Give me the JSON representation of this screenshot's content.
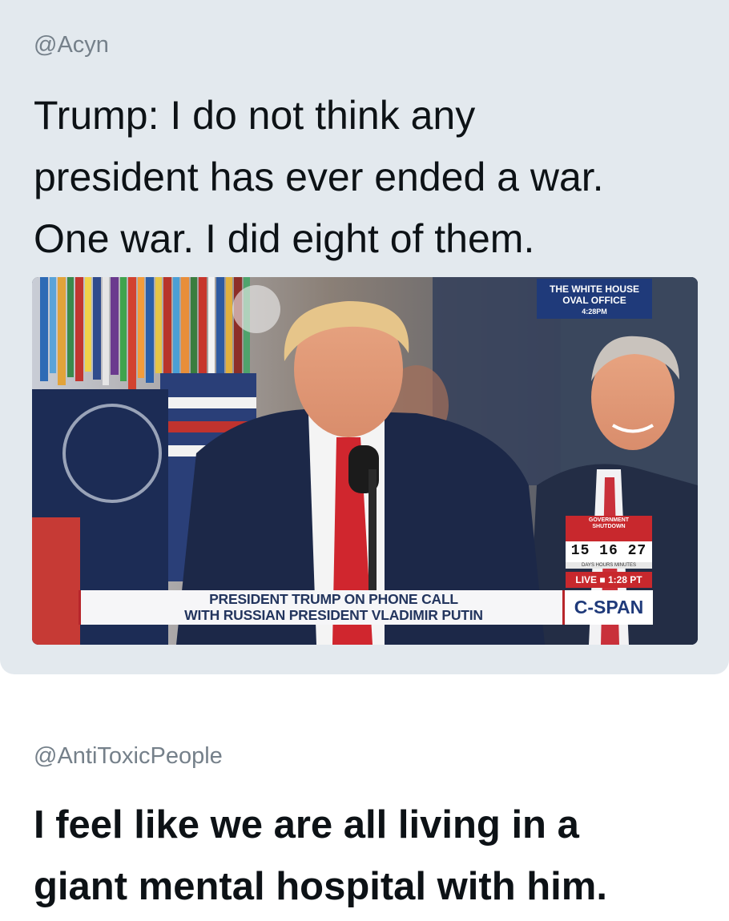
{
  "quoted_post": {
    "handle": "@Acyn",
    "text_lines": [
      "Trump: I do not think any",
      "president has ever ended a war.",
      "One war. I did eight of them."
    ],
    "media": {
      "chyron_lines": [
        "PRESIDENT TRUMP ON PHONE CALL",
        "WITH RUSSIAN PRESIDENT VLADIMIR PUTIN"
      ],
      "location_lines": [
        "THE WHITE HOUSE",
        "OVAL OFFICE",
        "4:28PM"
      ],
      "shutdown_lines": [
        "GOVERNMENT",
        "SHUTDOWN"
      ],
      "shutdown_counter": "15 16 27",
      "counter_units": "DAYS  HOURS  MINUTES",
      "live_label": "LIVE ■ 1:28 PT",
      "network_logo": "C-SPAN",
      "colors": {
        "chyron_text": "#23355e",
        "network_blue": "#1f3a7a",
        "alert_red": "#c8282d"
      }
    }
  },
  "reply_post": {
    "handle": "@AntiToxicPeople",
    "text_lines": [
      "I feel like we are all living in a",
      "giant mental hospital with him."
    ]
  }
}
